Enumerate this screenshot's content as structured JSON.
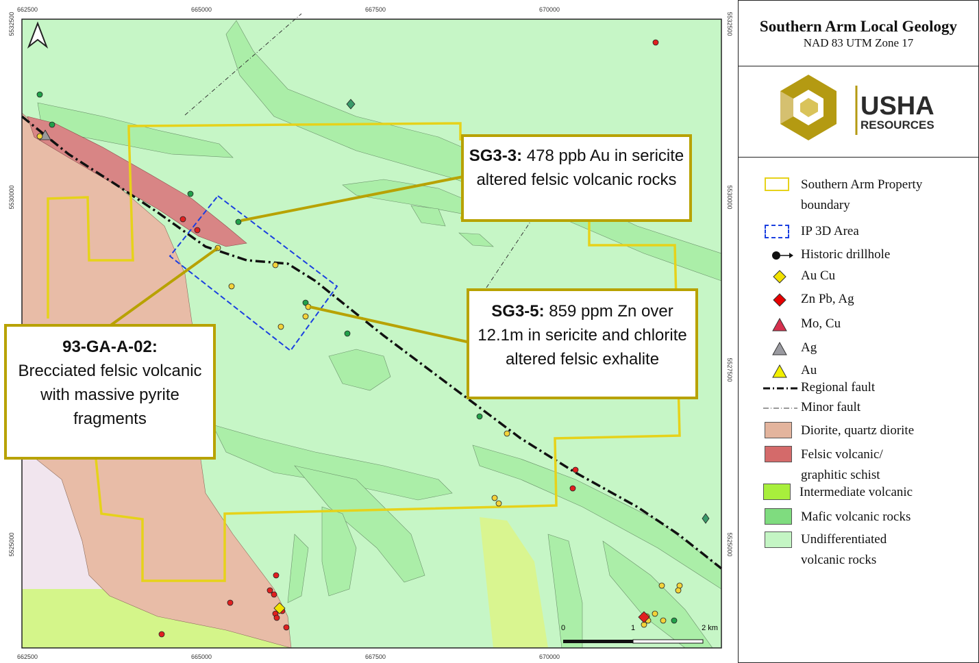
{
  "map": {
    "north_arrow": "north-arrow-icon",
    "x_ticks": [
      "662500",
      "665000",
      "667500",
      "670000"
    ],
    "y_ticks": [
      "5532500",
      "5530000",
      "5527500",
      "5525000"
    ],
    "scale_bar": {
      "labels": [
        "0",
        "1",
        "2 km"
      ]
    }
  },
  "callouts": {
    "sg33": {
      "id": "SG3-3:",
      "text": " 478 ppb Au in sericite altered felsic volcanic rocks"
    },
    "sg35": {
      "id": "SG3-5:",
      "text": " 859 ppm Zn over 12.1m in sericite and chlorite altered felsic exhalite"
    },
    "ga02": {
      "id": "93-GA-A-02:",
      "text": "Brecciated felsic volcanic with massive pyrite fragments"
    }
  },
  "title": {
    "main": "Southern Arm Local Geology",
    "sub": "NAD 83 UTM Zone 17"
  },
  "logo": {
    "line1": "USHA",
    "line2": "RESOURCES"
  },
  "legend": {
    "items": [
      {
        "icon": "property-boundary",
        "label": "Southern Arm Property boundary"
      },
      {
        "icon": "ip-3d-area",
        "label": "IP 3D Area"
      },
      {
        "icon": "historic-drillhole",
        "label": "Historic drillhole"
      },
      {
        "icon": "au-cu-diamond",
        "label": "Au Cu"
      },
      {
        "icon": "zn-pb-ag-diamond",
        "label": "Zn Pb, Ag"
      },
      {
        "icon": "mo-cu-triangle",
        "label": "Mo, Cu"
      },
      {
        "icon": "ag-triangle",
        "label": "Ag"
      },
      {
        "icon": "au-triangle",
        "label": "Au"
      },
      {
        "icon": "regional-fault",
        "label": "Regional fault"
      },
      {
        "icon": "minor-fault",
        "label": "Minor fault"
      },
      {
        "icon": "diorite",
        "label": "Diorite, quartz diorite"
      },
      {
        "icon": "felsic-volcanic",
        "label": "Felsic volcanic/ graphitic schist"
      },
      {
        "icon": "intermediate-volcanic",
        "label": "Intermediate volcanic"
      },
      {
        "icon": "mafic-volcanic",
        "label": "Mafic volcanic rocks"
      },
      {
        "icon": "undifferentiated-volcanic",
        "label": "Undifferentiated volcanic rocks"
      }
    ],
    "colors": {
      "boundary": "#e6d21a",
      "ip": "#1a3fe0",
      "diorite": "#e3b49d",
      "felsic": "#d46a6a",
      "intermediate": "#a8ef3c",
      "mafic": "#7fdc7f",
      "undiff": "#c4f5c4"
    }
  }
}
